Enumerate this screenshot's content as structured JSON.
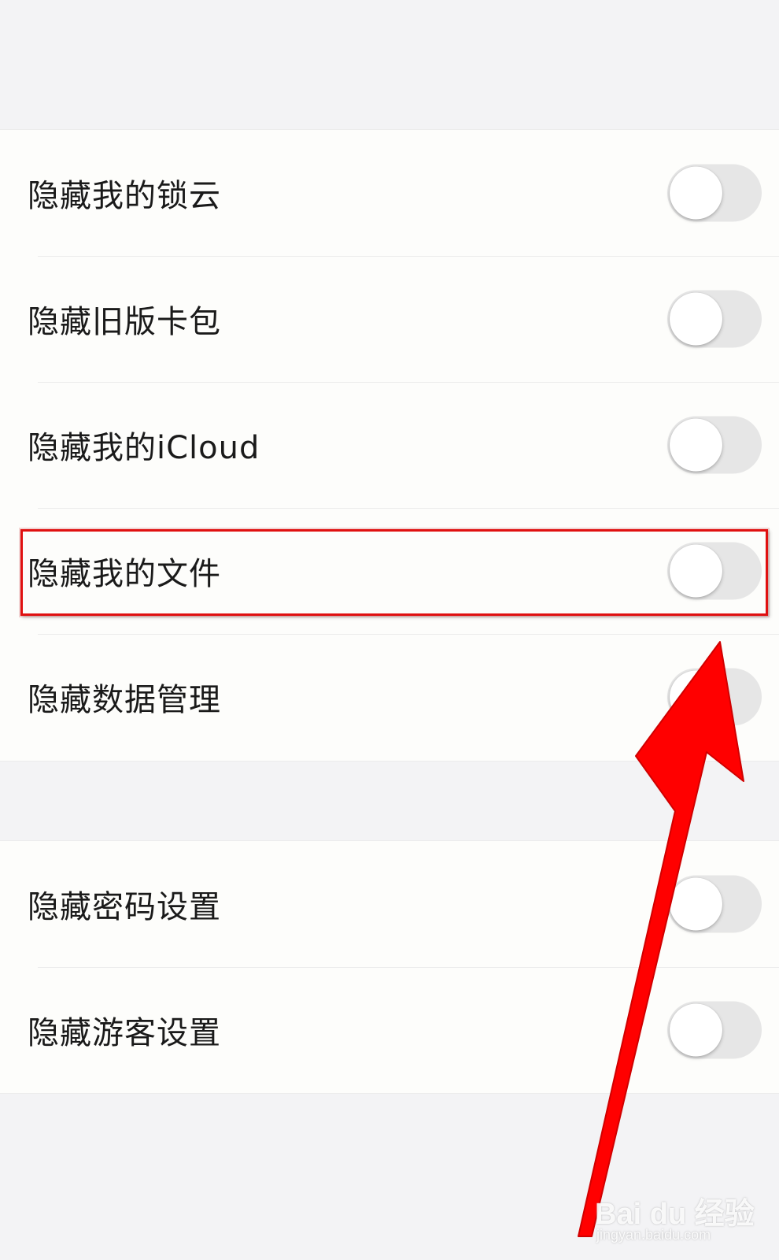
{
  "settings": {
    "group1": [
      {
        "label": "隐藏我的锁云",
        "enabled": false
      },
      {
        "label": "隐藏旧版卡包",
        "enabled": false
      },
      {
        "label": "隐藏我的iCloud",
        "enabled": false
      },
      {
        "label": "隐藏我的文件",
        "enabled": false
      },
      {
        "label": "隐藏数据管理",
        "enabled": false
      }
    ],
    "group2": [
      {
        "label": "隐藏密码设置",
        "enabled": false
      },
      {
        "label": "隐藏游客设置",
        "enabled": false
      }
    ]
  },
  "annotation": {
    "highlight_target": "隐藏我的文件",
    "highlight_color": "#e01010",
    "arrow_color": "#ff0000"
  },
  "watermark": {
    "logo": "Bai du 经验",
    "url": "jingyan.baidu.com"
  },
  "colors": {
    "page_background": "#f3f3f5",
    "row_background": "#fdfdfb",
    "toggle_off": "#e6e6e6"
  }
}
